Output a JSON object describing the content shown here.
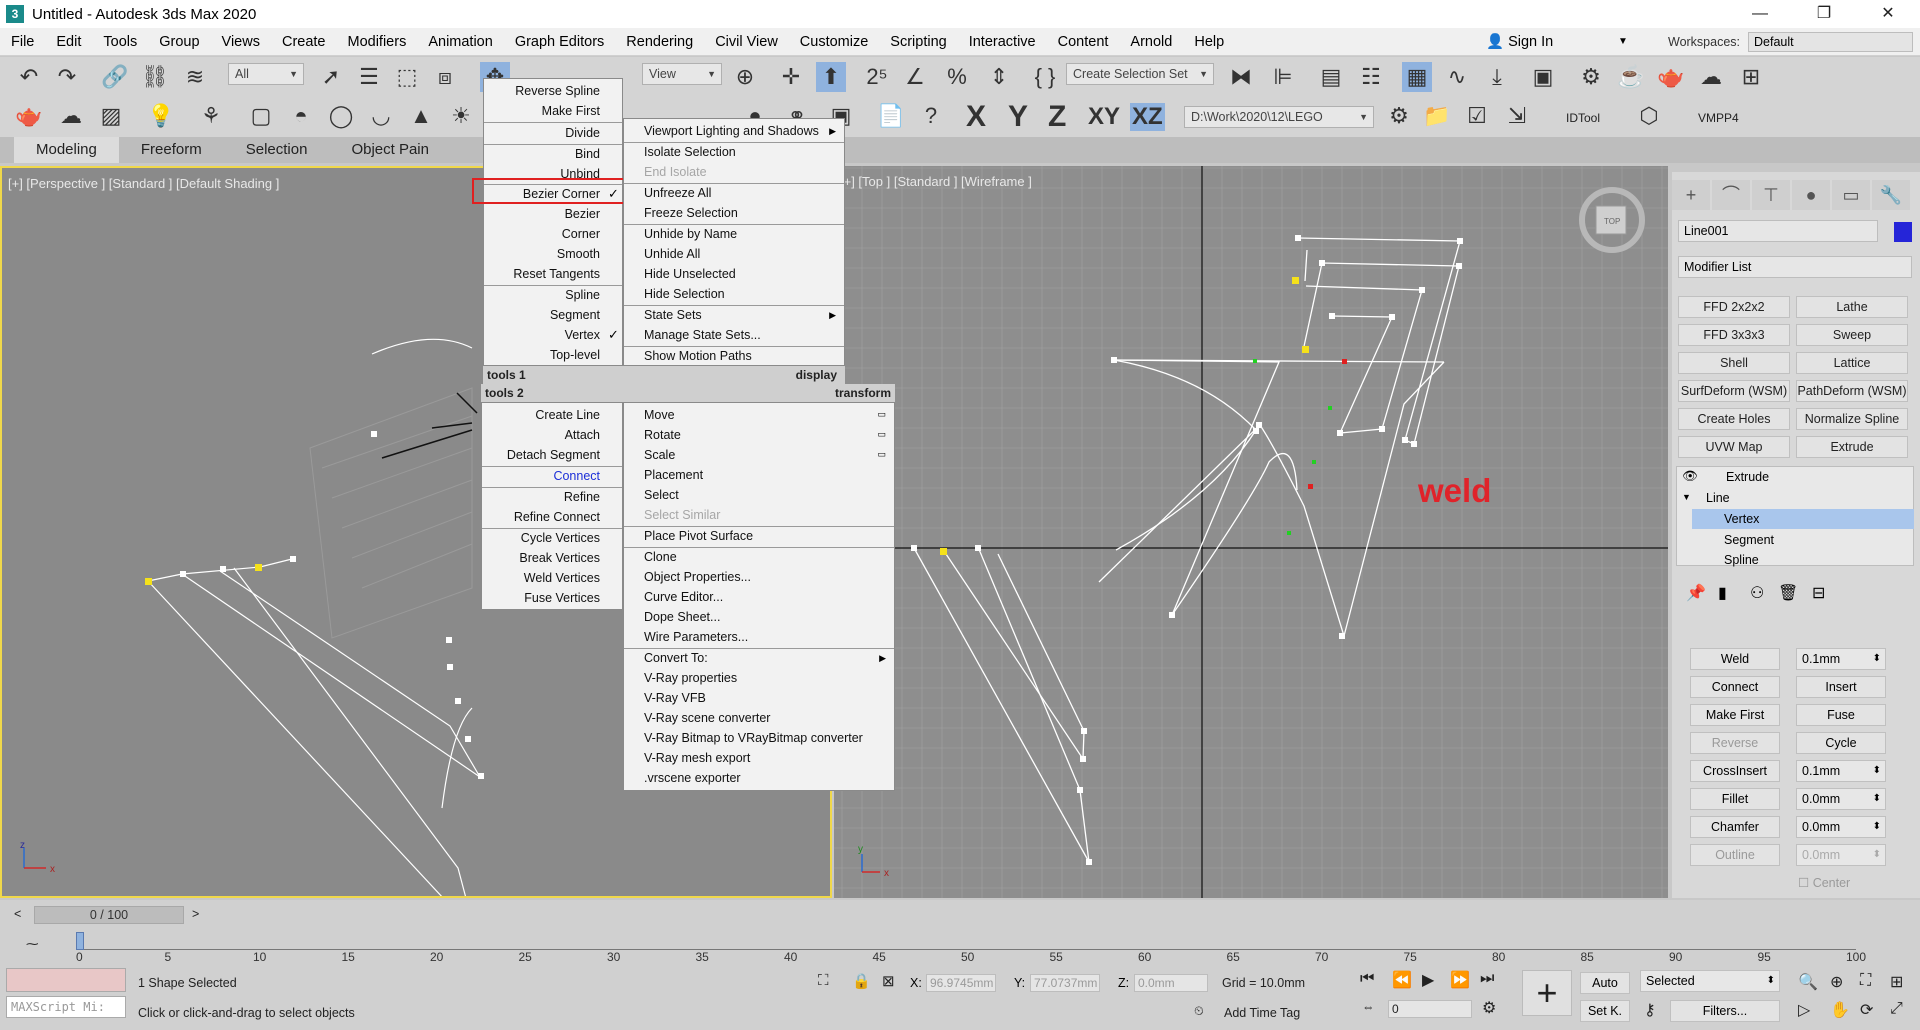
{
  "window": {
    "title": "Untitled - Autodesk 3ds Max 2020",
    "icon_label": "3",
    "minimize": "—",
    "maximize": "❐",
    "close": "✕"
  },
  "menubar": {
    "items": [
      "File",
      "Edit",
      "Tools",
      "Group",
      "Views",
      "Create",
      "Modifiers",
      "Animation",
      "Graph Editors",
      "Rendering",
      "Civil View",
      "Customize",
      "Scripting",
      "Interactive",
      "Content",
      "Arnold",
      "Help"
    ],
    "sign_in": "Sign In",
    "workspace_label": "Workspaces:",
    "workspace_value": "Default"
  },
  "toolbar": {
    "filter": "All",
    "view": "View",
    "selection_set": "Create Selection Set",
    "path": "D:\\Work\\2020\\12\\LEGO",
    "idtool": "IDTool",
    "vmpp": "VMPP4",
    "x": "X",
    "y": "Y",
    "z": "Z",
    "xy": "XY",
    "xz": "XZ"
  },
  "ribbon": {
    "tabs": [
      "Modeling",
      "Freeform",
      "Selection",
      "Object Pain"
    ]
  },
  "viewports": {
    "left_label": "[+] [Perspective ] [Standard ] [Default Shading ]",
    "right_label": "[+] [Top ] [Standard ] [Wireframe ]",
    "annotation": "weld",
    "compass_top": "TOP",
    "axis_x": "x",
    "axis_y": "y",
    "axis_z": "z"
  },
  "quad_left_top": {
    "items": [
      "Reverse Spline",
      "Make First",
      "Divide",
      "Bind",
      "Unbind",
      "Bezier Corner",
      "Bezier",
      "Corner",
      "Smooth",
      "Reset Tangents",
      "Spline",
      "Segment",
      "Vertex",
      "Top-level"
    ],
    "header": "tools 1",
    "check": "✓"
  },
  "quad_left_bottom": {
    "header": "tools 2",
    "items": [
      "Create Line",
      "Attach",
      "Detach Segment",
      "Connect",
      "Refine",
      "Refine Connect",
      "Cycle Vertices",
      "Break Vertices",
      "Weld Vertices",
      "Fuse Vertices"
    ]
  },
  "quad_right_top": {
    "items": [
      "Viewport Lighting and Shadows",
      "Isolate Selection",
      "End Isolate",
      "Unfreeze All",
      "Freeze Selection",
      "Unhide by Name",
      "Unhide All",
      "Hide Unselected",
      "Hide Selection",
      "State Sets",
      "Manage State Sets...",
      "Show Motion Paths"
    ],
    "header": "display"
  },
  "quad_right_bottom": {
    "header": "transform",
    "items": [
      "Move",
      "Rotate",
      "Scale",
      "Placement",
      "Select",
      "Select Similar",
      "Place Pivot Surface",
      "Clone",
      "Object Properties...",
      "Curve Editor...",
      "Dope Sheet...",
      "Wire Parameters...",
      "Convert To:",
      "V-Ray properties",
      "V-Ray VFB",
      "V-Ray scene converter",
      "V-Ray Bitmap to VRayBitmap converter",
      "V-Ray mesh export",
      ".vrscene exporter"
    ]
  },
  "command_panel": {
    "object_name": "Line001",
    "modifier_list": "Modifier List",
    "modifier_buttons": [
      "FFD 2x2x2",
      "Lathe",
      "FFD 3x3x3",
      "Sweep",
      "Shell",
      "Lattice",
      "SurfDeform (WSM)",
      "PathDeform (WSM)",
      "Create Holes",
      "Normalize Spline",
      "UVW Map",
      "Extrude"
    ],
    "stack": {
      "extrude": "Extrude",
      "line": "Line",
      "vertex": "Vertex",
      "segment": "Segment",
      "spline": "Spline"
    },
    "rollout": {
      "weld": "Weld",
      "weld_val": "0.1mm",
      "connect": "Connect",
      "insert": "Insert",
      "make_first": "Make First",
      "fuse": "Fuse",
      "reverse": "Reverse",
      "cycle": "Cycle",
      "crossinsert": "CrossInsert",
      "crossinsert_val": "0.1mm",
      "fillet": "Fillet",
      "fillet_val": "0.0mm",
      "chamfer": "Chamfer",
      "chamfer_val": "0.0mm",
      "outline": "Outline",
      "outline_val": "0.0mm",
      "center": "Center"
    }
  },
  "timeline": {
    "slider": "0 / 100",
    "ticks": [
      "0",
      "5",
      "10",
      "15",
      "20",
      "25",
      "30",
      "35",
      "40",
      "45",
      "50",
      "55",
      "60",
      "65",
      "70",
      "75",
      "80",
      "85",
      "90",
      "95",
      "100"
    ]
  },
  "status": {
    "selected": "1 Shape Selected",
    "prompt": "Click or click-and-drag to select objects",
    "maxscript": "MAXScript Mi:",
    "x_label": "X:",
    "x_val": "96.9745mm",
    "y_label": "Y:",
    "y_val": "77.0737mm",
    "z_label": "Z:",
    "z_val": "0.0mm",
    "grid": "Grid = 10.0mm",
    "add_time_tag": "Add Time Tag",
    "frame": "0",
    "auto": "Auto",
    "set_key": "Set K.",
    "key_mode": "Selected",
    "filters": "Filters..."
  },
  "colors": {
    "accent_yellow": "#f0d84a",
    "weld_red": "#e0232a",
    "object_color": "#2525d8"
  }
}
